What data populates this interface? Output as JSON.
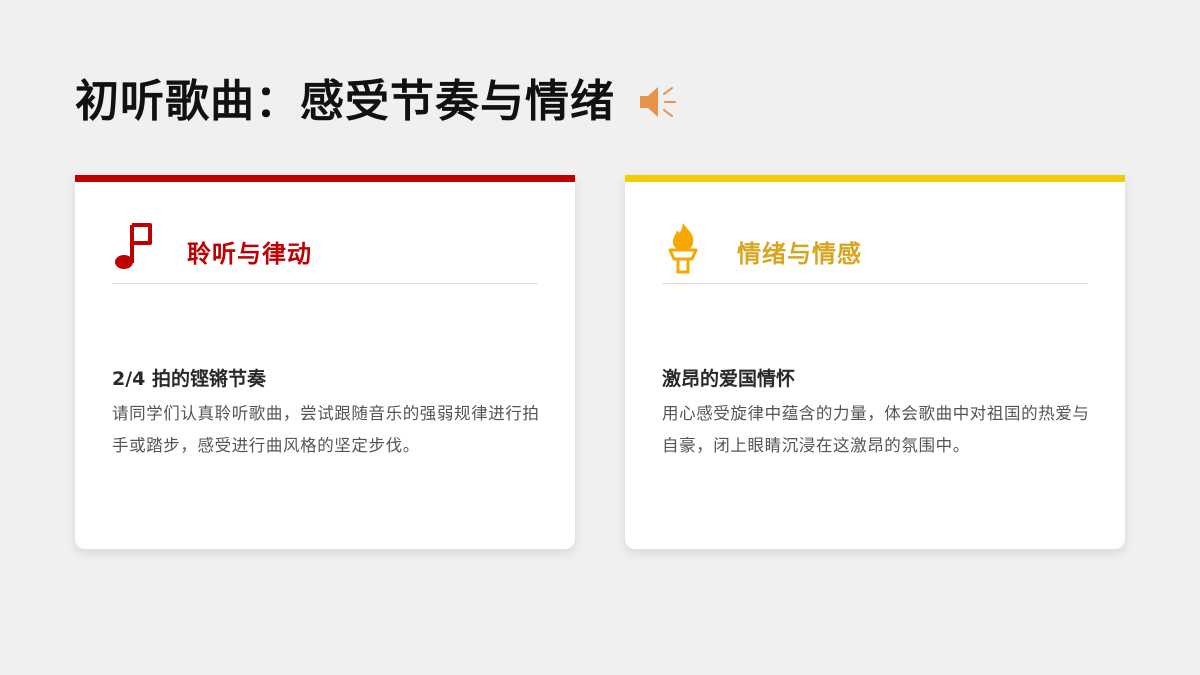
{
  "header": {
    "title": "初听歌曲：感受节奏与情绪",
    "icon": "speaker-icon",
    "icon_color": "#e8914a"
  },
  "cards": [
    {
      "title": "聆听与律动",
      "icon": "music-note-icon",
      "accent": "#c00000",
      "subtitle": "2/4 拍的铿锵节奏",
      "body": "请同学们认真聆听歌曲，尝试跟随音乐的强弱规律进行拍手或踏步，感受进行曲风格的坚定步伐。"
    },
    {
      "title": "情绪与情感",
      "icon": "torch-icon",
      "accent": "#f5cc00",
      "title_color": "#d9a520",
      "subtitle": "激昂的爱国情怀",
      "body": "用心感受旋律中蕴含的力量，体会歌曲中对祖国的热爱与自豪，闭上眼睛沉浸在这激昂的氛围中。"
    }
  ]
}
